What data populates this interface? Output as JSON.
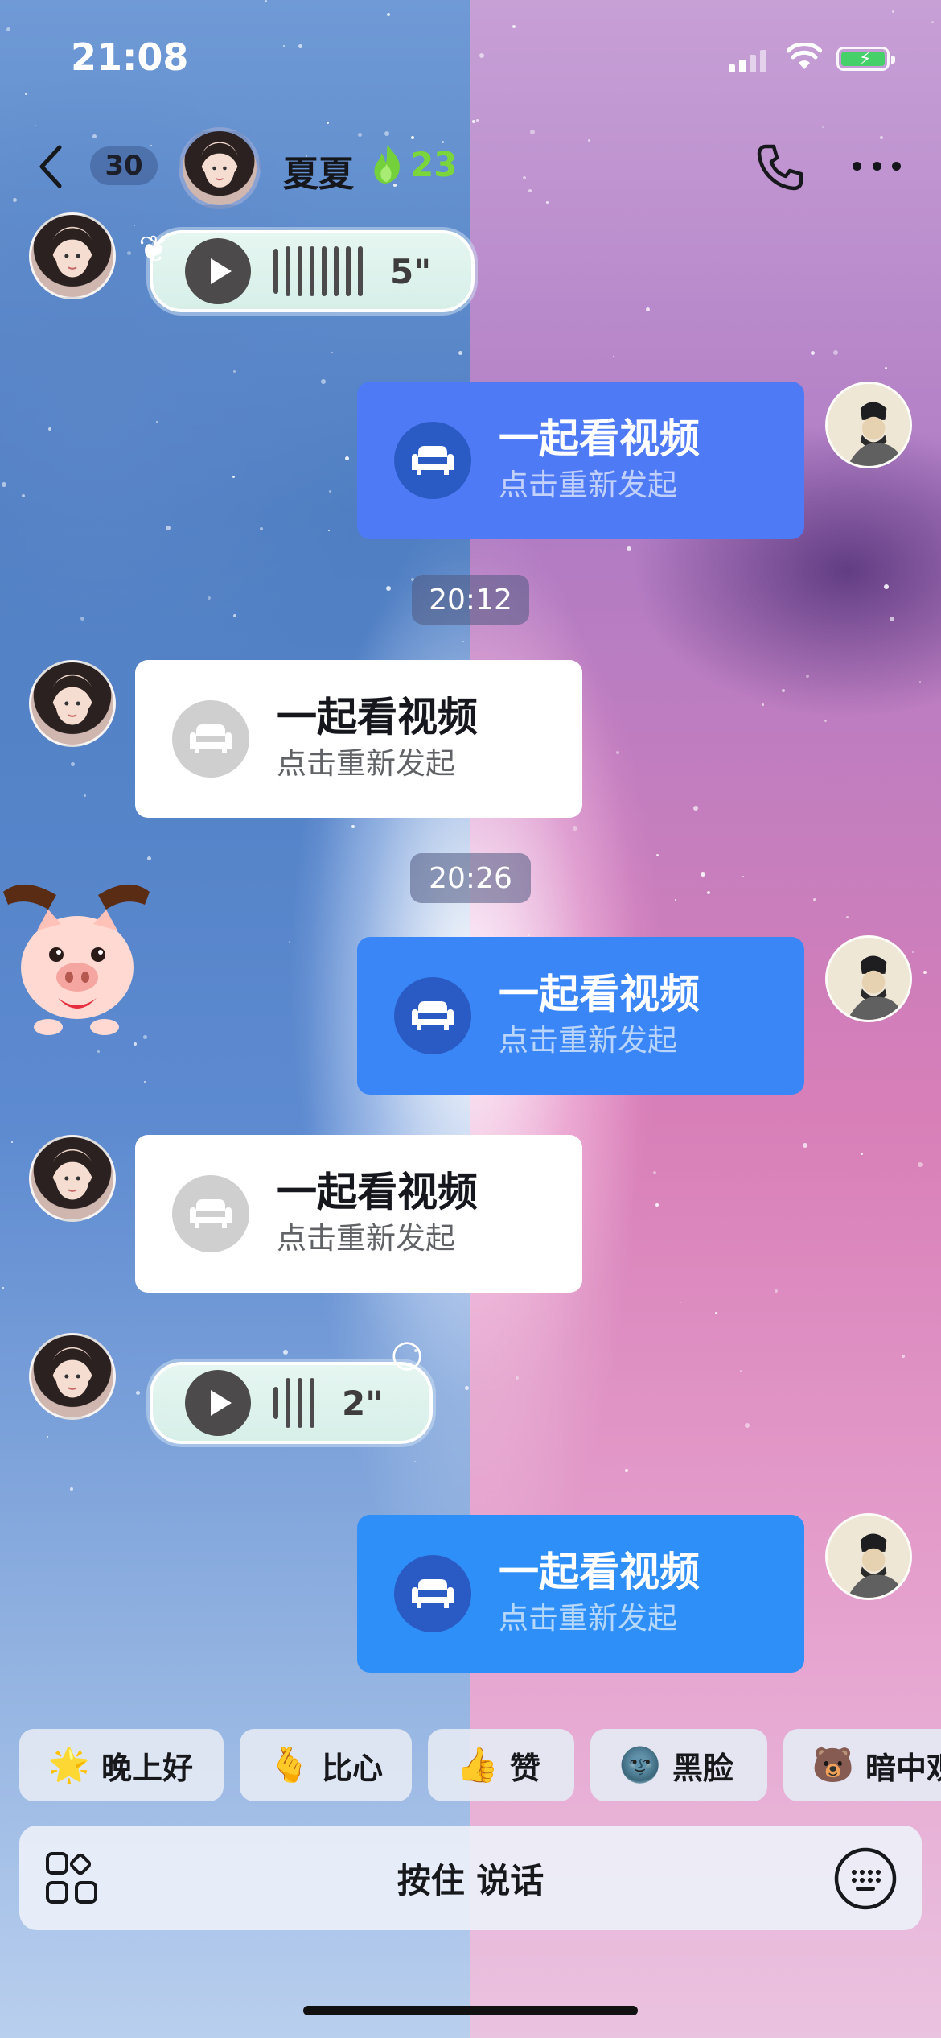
{
  "status_bar": {
    "time": "21:08"
  },
  "nav": {
    "unread_count": "30",
    "contact_name": "夏夏",
    "streak_days": "23",
    "icons": [
      "back-chevron-icon",
      "phone-icon",
      "more-dots-icon",
      "flame-icon"
    ]
  },
  "messages": [
    {
      "type": "voice",
      "side": "received",
      "duration": "5\""
    },
    {
      "type": "watch_together",
      "side": "sent",
      "title": "一起看视频",
      "subtitle": "点击重新发起"
    },
    {
      "type": "timestamp",
      "text": "20:12"
    },
    {
      "type": "watch_together",
      "side": "received",
      "title": "一起看视频",
      "subtitle": "点击重新发起"
    },
    {
      "type": "timestamp",
      "text": "20:26"
    },
    {
      "type": "watch_together",
      "side": "sent",
      "title": "一起看视频",
      "subtitle": "点击重新发起"
    },
    {
      "type": "watch_together",
      "side": "received",
      "title": "一起看视频",
      "subtitle": "点击重新发起"
    },
    {
      "type": "voice",
      "side": "received",
      "duration": "2\""
    },
    {
      "type": "watch_together",
      "side": "sent",
      "title": "一起看视频",
      "subtitle": "点击重新发起"
    }
  ],
  "quick_replies": [
    {
      "emoji": "🌟",
      "label": "晚上好"
    },
    {
      "emoji": "🫰",
      "label": "比心"
    },
    {
      "emoji": "👍",
      "label": "赞"
    },
    {
      "emoji": "🌚",
      "label": "黑脸"
    },
    {
      "emoji": "🐻",
      "label": "暗中观"
    }
  ],
  "input_bar": {
    "hold_to_talk": "按住 说话"
  },
  "colors": {
    "sent_card_1": "#4f7af5",
    "sent_card_2": "#3a86f7",
    "sent_card_3": "#2f8ff8",
    "received_card": "#ffffff",
    "streak_green": "#7ad63a"
  }
}
